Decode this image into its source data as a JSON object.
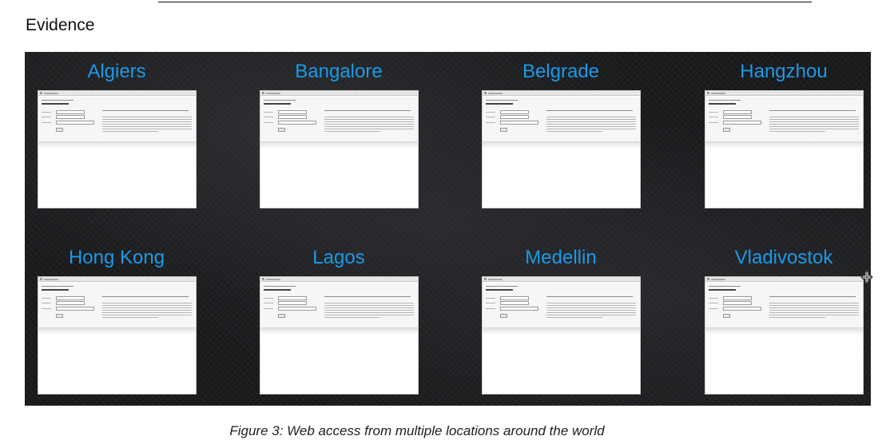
{
  "section_heading": "Evidence",
  "cities": [
    "Algiers",
    "Bangalore",
    "Belgrade",
    "Hangzhou",
    "Hong Kong",
    "Lagos",
    "Medellin",
    "Vladivostok"
  ],
  "caption": "Figure 3: Web access from multiple locations around the world",
  "colors": {
    "city_label": "#1a9ae8",
    "background": "#1b1c1e"
  }
}
